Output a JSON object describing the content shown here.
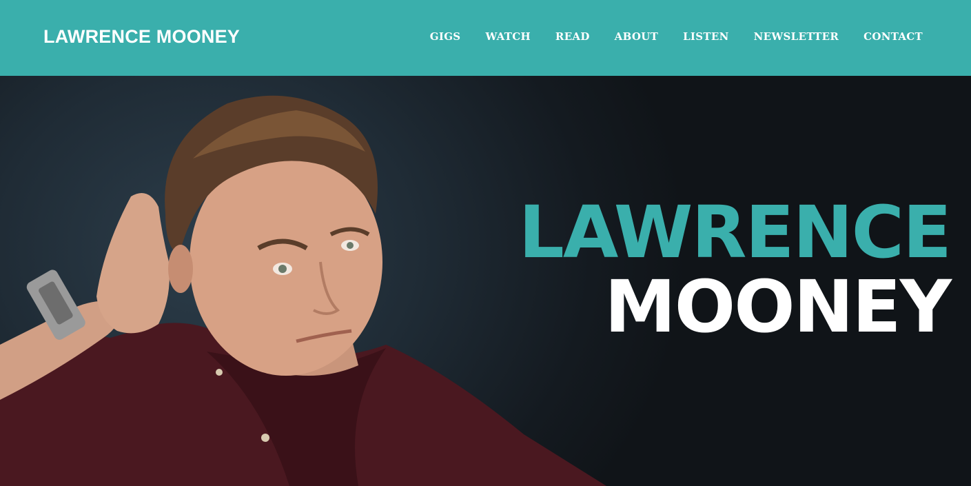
{
  "header": {
    "logo": "LAWRENCE MOONEY",
    "nav": [
      "GIGS",
      "WATCH",
      "READ",
      "ABOUT",
      "LISTEN",
      "NEWSLETTER",
      "CONTACT"
    ]
  },
  "hero": {
    "title_line1": "LAWRENCE",
    "title_line2": "MOONEY"
  },
  "colors": {
    "accent": "#3aafac",
    "hero_bg": "#1a2128",
    "shirt": "#4a1820"
  }
}
